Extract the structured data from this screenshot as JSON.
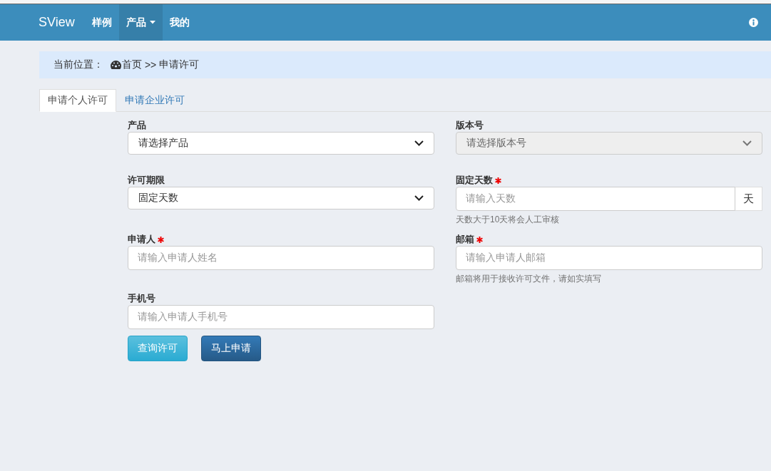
{
  "navbar": {
    "brand": "SView",
    "items": [
      {
        "label": "样例",
        "selected": false,
        "dropdown": false
      },
      {
        "label": "产品",
        "selected": true,
        "dropdown": true
      },
      {
        "label": "我的",
        "selected": false,
        "dropdown": false
      }
    ]
  },
  "breadcrumb": {
    "prefix": "当前位置：",
    "home": "首页",
    "separator": ">>",
    "current": "申请许可"
  },
  "tabs": [
    {
      "label": "申请个人许可",
      "selected": true
    },
    {
      "label": "申请企业许可",
      "selected": false
    }
  ],
  "fields": [
    {
      "kind": "select",
      "label": "产品",
      "required": false,
      "value": "请选择产品",
      "disabled": false
    },
    {
      "kind": "select",
      "label": "版本号",
      "required": false,
      "value": "请选择版本号",
      "disabled": true
    },
    {
      "kind": "select",
      "label": "许可期限",
      "required": false,
      "value": "固定天数",
      "disabled": false
    },
    {
      "kind": "addon",
      "label": "固定天数",
      "required": true,
      "placeholder": "请输入天数",
      "addon": "天",
      "help": "天数大于10天将会人工审核"
    },
    {
      "kind": "input",
      "label": "申请人",
      "required": true,
      "placeholder": "请输入申请人姓名"
    },
    {
      "kind": "input",
      "label": "邮箱",
      "required": true,
      "placeholder": "请输入申请人邮箱",
      "help": "邮箱将用于接收许可文件，请如实填写"
    },
    {
      "kind": "input",
      "label": "手机号",
      "required": false,
      "placeholder": "请输入申请人手机号"
    }
  ],
  "buttons": [
    {
      "label": "查询许可",
      "kind": "info"
    },
    {
      "label": "马上申请",
      "kind": "primary"
    }
  ]
}
